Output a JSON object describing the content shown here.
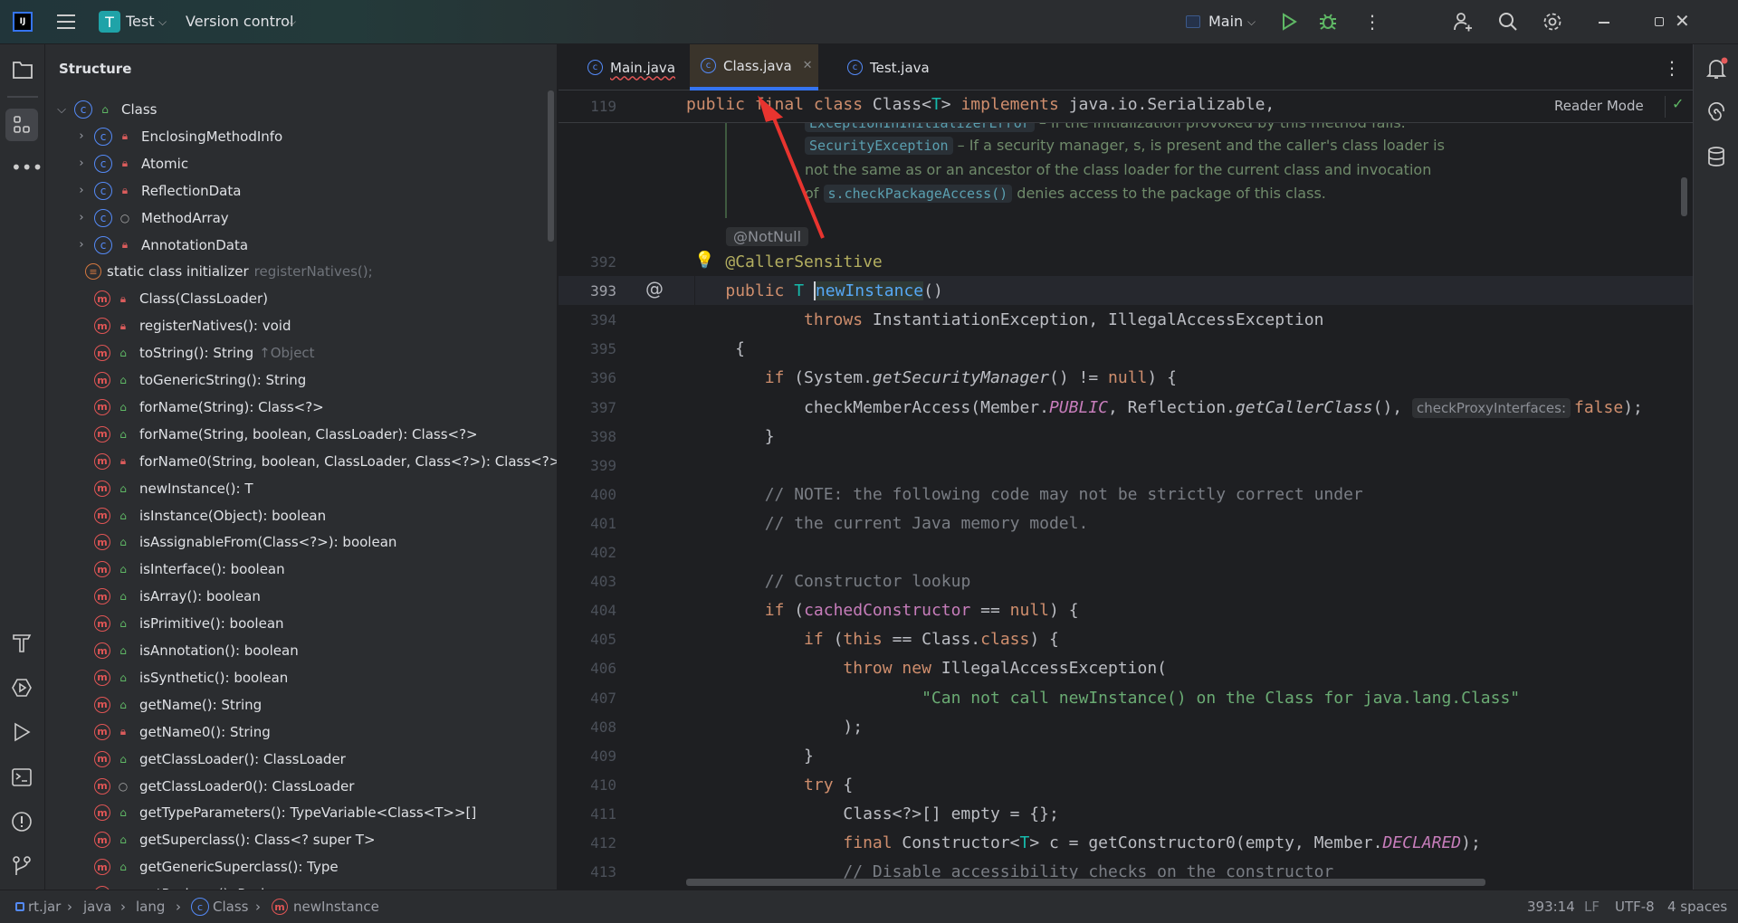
{
  "titlebar": {
    "logo": "IJ",
    "project_badge": "T",
    "project_name": "Test",
    "vcs_label": "Version control",
    "run_config": "Main",
    "accent": "#3574f0"
  },
  "structure": {
    "title": "Structure",
    "items": [
      {
        "label": "Class",
        "kind": "class",
        "vis": "public",
        "level": 0,
        "expander": "open",
        "hint": ""
      },
      {
        "label": "EnclosingMethodInfo",
        "kind": "class",
        "vis": "private",
        "level": 1,
        "expander": "closed",
        "hint": ""
      },
      {
        "label": "Atomic",
        "kind": "class",
        "vis": "private",
        "level": 1,
        "expander": "closed",
        "hint": ""
      },
      {
        "label": "ReflectionData",
        "kind": "class",
        "vis": "private",
        "level": 1,
        "expander": "closed",
        "hint": ""
      },
      {
        "label": "MethodArray",
        "kind": "class",
        "vis": "package",
        "level": 1,
        "expander": "closed",
        "hint": ""
      },
      {
        "label": "AnnotationData",
        "kind": "class",
        "vis": "private",
        "level": 1,
        "expander": "closed",
        "hint": ""
      },
      {
        "label": "static class initializer",
        "kind": "static",
        "vis": "",
        "level": 1,
        "expander": "",
        "hint": "registerNatives();"
      },
      {
        "label": "Class(ClassLoader)",
        "kind": "method",
        "vis": "private",
        "level": 1,
        "expander": "",
        "hint": ""
      },
      {
        "label": "registerNatives(): void",
        "kind": "method",
        "vis": "private",
        "level": 1,
        "expander": "",
        "hint": ""
      },
      {
        "label": "toString(): String",
        "kind": "method",
        "vis": "public",
        "level": 1,
        "expander": "",
        "hint": "↑Object"
      },
      {
        "label": "toGenericString(): String",
        "kind": "method",
        "vis": "public",
        "level": 1,
        "expander": "",
        "hint": ""
      },
      {
        "label": "forName(String): Class<?>",
        "kind": "method",
        "vis": "public",
        "level": 1,
        "expander": "",
        "hint": ""
      },
      {
        "label": "forName(String, boolean, ClassLoader): Class<?>",
        "kind": "method",
        "vis": "public",
        "level": 1,
        "expander": "",
        "hint": ""
      },
      {
        "label": "forName0(String, boolean, ClassLoader, Class<?>): Class<?>",
        "kind": "method",
        "vis": "private",
        "level": 1,
        "expander": "",
        "hint": ""
      },
      {
        "label": "newInstance(): T",
        "kind": "method",
        "vis": "public",
        "level": 1,
        "expander": "",
        "hint": ""
      },
      {
        "label": "isInstance(Object): boolean",
        "kind": "method",
        "vis": "public",
        "level": 1,
        "expander": "",
        "hint": ""
      },
      {
        "label": "isAssignableFrom(Class<?>): boolean",
        "kind": "method",
        "vis": "public",
        "level": 1,
        "expander": "",
        "hint": ""
      },
      {
        "label": "isInterface(): boolean",
        "kind": "method",
        "vis": "public",
        "level": 1,
        "expander": "",
        "hint": ""
      },
      {
        "label": "isArray(): boolean",
        "kind": "method",
        "vis": "public",
        "level": 1,
        "expander": "",
        "hint": ""
      },
      {
        "label": "isPrimitive(): boolean",
        "kind": "method",
        "vis": "public",
        "level": 1,
        "expander": "",
        "hint": ""
      },
      {
        "label": "isAnnotation(): boolean",
        "kind": "method",
        "vis": "public",
        "level": 1,
        "expander": "",
        "hint": ""
      },
      {
        "label": "isSynthetic(): boolean",
        "kind": "method",
        "vis": "public",
        "level": 1,
        "expander": "",
        "hint": ""
      },
      {
        "label": "getName(): String",
        "kind": "method",
        "vis": "public",
        "level": 1,
        "expander": "",
        "hint": ""
      },
      {
        "label": "getName0(): String",
        "kind": "method",
        "vis": "private",
        "level": 1,
        "expander": "",
        "hint": ""
      },
      {
        "label": "getClassLoader(): ClassLoader",
        "kind": "method",
        "vis": "public",
        "level": 1,
        "expander": "",
        "hint": ""
      },
      {
        "label": "getClassLoader0(): ClassLoader",
        "kind": "method",
        "vis": "package",
        "level": 1,
        "expander": "",
        "hint": ""
      },
      {
        "label": "getTypeParameters(): TypeVariable<Class<T>>[]",
        "kind": "method",
        "vis": "public",
        "level": 1,
        "expander": "",
        "hint": ""
      },
      {
        "label": "getSuperclass(): Class<? super T>",
        "kind": "method",
        "vis": "public",
        "level": 1,
        "expander": "",
        "hint": ""
      },
      {
        "label": "getGenericSuperclass(): Type",
        "kind": "method",
        "vis": "public",
        "level": 1,
        "expander": "",
        "hint": ""
      },
      {
        "label": "getPackage(): Package",
        "kind": "method",
        "vis": "public",
        "level": 1,
        "expander": "",
        "hint": ""
      }
    ]
  },
  "tabs": [
    {
      "label": "Main.java",
      "active": false
    },
    {
      "label": "Class.java",
      "active": true
    },
    {
      "label": "Test.java",
      "active": false
    }
  ],
  "editor": {
    "reader_mode": "Reader Mode",
    "sticky": {
      "n": "119",
      "t": [
        [
          "public final class ",
          "kw"
        ],
        [
          "Class<",
          ""
        ],
        [
          "T",
          "tp"
        ],
        [
          "> ",
          ""
        ],
        [
          "implements ",
          "kw"
        ],
        [
          "java.io.Serializable,",
          ""
        ]
      ]
    },
    "doc": {
      "line1_code": "ExceptionInInitializerError",
      "line1_text": " – if the initialization provoked by this method fails.",
      "line2_code": "SecurityException",
      "line2_text": " – If a security manager, s, is present and the caller's class loader is",
      "line3_text": "not the same as or an ancestor of the class loader for the current class and invocation",
      "line4_pre": "of ",
      "line4_code": "s.checkPackageAccess()",
      "line4_text": " denies access to the package of this class."
    },
    "notnull_badge": "@NotNull",
    "current_line": "393",
    "lines": [
      {
        "n": "392",
        "t": [
          [
            "    ",
            ""
          ],
          [
            "@CallerSensitive",
            "an"
          ]
        ]
      },
      {
        "n": "393",
        "t": [
          [
            "    ",
            ""
          ],
          [
            "public ",
            "kw"
          ],
          [
            "T ",
            "tp"
          ],
          [
            "newInstance",
            "dc"
          ],
          [
            "()",
            ""
          ]
        ]
      },
      {
        "n": "394",
        "t": [
          [
            "            ",
            ""
          ],
          [
            "throws ",
            "kw"
          ],
          [
            "InstantiationException, IllegalAccessException",
            ""
          ]
        ]
      },
      {
        "n": "395",
        "t": [
          [
            "     {",
            ""
          ]
        ]
      },
      {
        "n": "396",
        "t": [
          [
            "        ",
            ""
          ],
          [
            "if ",
            "kw"
          ],
          [
            "(System.",
            ""
          ],
          [
            "getSecurityManager",
            "it"
          ],
          [
            "() != ",
            ""
          ],
          [
            "null",
            "kw"
          ],
          [
            ") {",
            ""
          ]
        ]
      },
      {
        "n": "397",
        "t": [
          [
            "            checkMemberAccess(Member.",
            ""
          ],
          [
            "PUBLIC",
            "cs"
          ],
          [
            ", Reflection.",
            ""
          ],
          [
            "getCallerClass",
            "it"
          ],
          [
            "(), ",
            ""
          ],
          [
            "checkProxyInterfaces:",
            "hint"
          ],
          [
            "false",
            "kw"
          ],
          [
            ");",
            ""
          ]
        ]
      },
      {
        "n": "398",
        "t": [
          [
            "        }",
            ""
          ]
        ]
      },
      {
        "n": "399",
        "t": []
      },
      {
        "n": "400",
        "t": [
          [
            "        ",
            ""
          ],
          [
            "// NOTE: the following code may not be strictly correct under",
            "cm"
          ]
        ]
      },
      {
        "n": "401",
        "t": [
          [
            "        ",
            ""
          ],
          [
            "// the current Java memory model.",
            "cm"
          ]
        ]
      },
      {
        "n": "402",
        "t": []
      },
      {
        "n": "403",
        "t": [
          [
            "        ",
            ""
          ],
          [
            "// Constructor lookup",
            "cm"
          ]
        ]
      },
      {
        "n": "404",
        "t": [
          [
            "        ",
            ""
          ],
          [
            "if ",
            "kw"
          ],
          [
            "(",
            ""
          ],
          [
            "cachedConstructor",
            "fd"
          ],
          [
            " == ",
            ""
          ],
          [
            "null",
            "kw"
          ],
          [
            ") {",
            ""
          ]
        ]
      },
      {
        "n": "405",
        "t": [
          [
            "            ",
            ""
          ],
          [
            "if ",
            "kw"
          ],
          [
            "(",
            ""
          ],
          [
            "this",
            "kw"
          ],
          [
            " == Class.",
            ""
          ],
          [
            "class",
            "kw"
          ],
          [
            ") {",
            ""
          ]
        ]
      },
      {
        "n": "406",
        "t": [
          [
            "                ",
            ""
          ],
          [
            "throw new ",
            "kw"
          ],
          [
            "IllegalAccessException(",
            ""
          ]
        ]
      },
      {
        "n": "407",
        "t": [
          [
            "                        ",
            ""
          ],
          [
            "\"Can not call newInstance() on the Class for java.lang.Class\"",
            "st"
          ]
        ]
      },
      {
        "n": "408",
        "t": [
          [
            "                );",
            ""
          ]
        ]
      },
      {
        "n": "409",
        "t": [
          [
            "            }",
            ""
          ]
        ]
      },
      {
        "n": "410",
        "t": [
          [
            "            ",
            ""
          ],
          [
            "try ",
            "kw"
          ],
          [
            "{",
            ""
          ]
        ]
      },
      {
        "n": "411",
        "t": [
          [
            "                Class<?>[] empty = {};",
            ""
          ]
        ]
      },
      {
        "n": "412",
        "t": [
          [
            "                ",
            ""
          ],
          [
            "final ",
            "kw"
          ],
          [
            "Constructor<",
            ""
          ],
          [
            "T",
            "tp"
          ],
          [
            "> c = getConstructor0(empty, Member.",
            ""
          ],
          [
            "DECLARED",
            "cs"
          ],
          [
            ");",
            ""
          ]
        ]
      },
      {
        "n": "413",
        "t": [
          [
            "                ",
            ""
          ],
          [
            "// Disable accessibility checks on the constructor",
            "cm"
          ]
        ]
      }
    ]
  },
  "statusbar": {
    "breadcrumbs": [
      "rt.jar",
      "java",
      "lang",
      "Class",
      "newInstance"
    ],
    "position": "393:14",
    "line_ending": "LF",
    "encoding": "UTF-8",
    "indent": "4 spaces"
  },
  "annotation_arrow_color": "#e8342f"
}
